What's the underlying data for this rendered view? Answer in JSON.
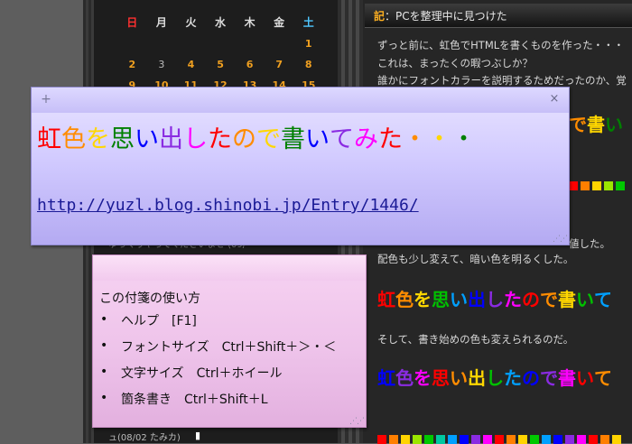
{
  "blog": {
    "calendar": {
      "weekdays": [
        "日",
        "月",
        "火",
        "水",
        "木",
        "金",
        "土"
      ],
      "rows": [
        [
          "",
          "",
          "",
          "",
          "",
          "",
          "1"
        ],
        [
          "2",
          "3",
          "4",
          "5",
          "6",
          "7",
          "8"
        ],
        [
          "9",
          "10",
          "11",
          "12",
          "13",
          "14",
          "15"
        ]
      ]
    },
    "sidebar_comment_fragment": "ゆっくりやってくださいませ (09/",
    "sidebar_bottom_fragment": "ュ(08/02 たみカ)",
    "post": {
      "title_mark": "記",
      "title_text": "：PCを整理中に見つけた",
      "paragraph_lines": [
        "ずっと前に、虹色でHTMLを書くものを作った・・・",
        "これは、まったくの暇つぶしか？",
        "誰かにフォントカラーを説明するためだったのか、覚"
      ],
      "rainbow_fragment_1": "で書い",
      "line_4": "値した。",
      "line_5": "配色も少し変えて、暗い色を明るくした。",
      "rainbow_2": "虹色を思い出したので書いて",
      "line_6": "そして、書き始めの色も変えられるのだ。",
      "rainbow_3": "虹色を思い出したので書いて"
    },
    "swatch_colors": [
      "#ff0000",
      "#ff7f00",
      "#ffd400",
      "#9be600",
      "#00c800",
      "#00c8a0",
      "#00a0ff",
      "#0000ff",
      "#8a2be2",
      "#ff00ff",
      "#ff0000",
      "#ff7f00",
      "#ffd400",
      "#00c800",
      "#00a0ff",
      "#0000ff",
      "#8a2be2",
      "#ff00ff",
      "#ff0000",
      "#ff7f00",
      "#ffd400",
      "#00c800",
      "#00a0ff",
      "#0000ff",
      "#8a2be2",
      "#ff00ff",
      "#ff0000",
      "#ff7f00",
      "#ffd400",
      "#00c800"
    ]
  },
  "notes": {
    "purple": {
      "plus_glyph": "+",
      "close_glyph": "×",
      "heading": "虹色を思い出したので書いてみた・・・",
      "link": "http://yuzl.blog.shinobi.jp/Entry/1446/",
      "rainbow_colors": [
        "#ff0000",
        "#ff8c00",
        "#ffd700",
        "#008000",
        "#0000ff",
        "#8a2be2",
        "#ff00ff",
        "#ff0000",
        "#ff8c00",
        "#ffd700",
        "#008000",
        "#0000ff",
        "#8a2be2",
        "#ff00ff",
        "#ff0000",
        "#ff8c00",
        "#ffd700",
        "#008000"
      ]
    },
    "pink": {
      "title": "この付箋の使い方",
      "items": [
        "ヘルプ　[F1]",
        "フォントサイズ　Ctrl＋Shift＋＞・＜",
        "文字サイズ　Ctrl＋ホイール",
        "箇条書き　Ctrl＋Shift＋L"
      ],
      "bullet": "•"
    }
  }
}
